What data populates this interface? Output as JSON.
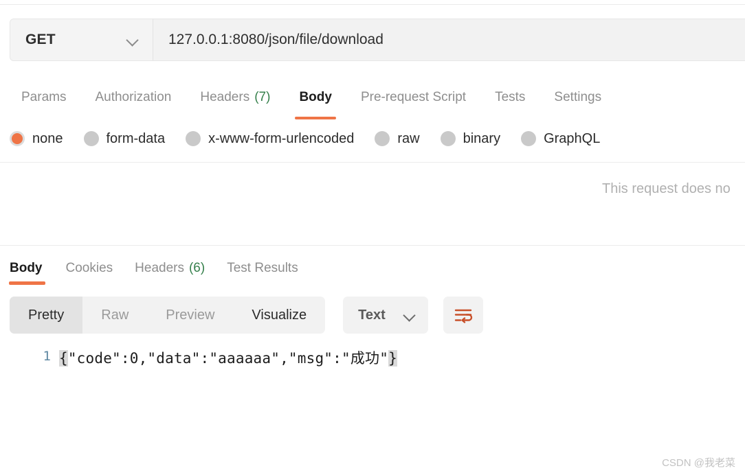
{
  "request_bar": {
    "method": "GET",
    "method_caret": "chevron-down-icon",
    "url": "127.0.0.1:8080/json/file/download"
  },
  "request_tabs": [
    {
      "label": "Params",
      "count": "",
      "active": false
    },
    {
      "label": "Authorization",
      "count": "",
      "active": false
    },
    {
      "label": "Headers",
      "count": "(7)",
      "active": false
    },
    {
      "label": "Body",
      "count": "",
      "active": true
    },
    {
      "label": "Pre-request Script",
      "count": "",
      "active": false
    },
    {
      "label": "Tests",
      "count": "",
      "active": false
    },
    {
      "label": "Settings",
      "count": "",
      "active": false
    }
  ],
  "body_types": [
    {
      "label": "none",
      "selected": true
    },
    {
      "label": "form-data",
      "selected": false
    },
    {
      "label": "x-www-form-urlencoded",
      "selected": false
    },
    {
      "label": "raw",
      "selected": false
    },
    {
      "label": "binary",
      "selected": false
    },
    {
      "label": "GraphQL",
      "selected": false
    }
  ],
  "empty_body_note": "This request does no",
  "response_tabs": [
    {
      "label": "Body",
      "count": "",
      "active": true
    },
    {
      "label": "Cookies",
      "count": "",
      "active": false
    },
    {
      "label": "Headers",
      "count": "(6)",
      "active": false
    },
    {
      "label": "Test Results",
      "count": "",
      "active": false
    }
  ],
  "viewer_toolbar": {
    "modes": [
      {
        "label": "Pretty",
        "active": true,
        "strong": false
      },
      {
        "label": "Raw",
        "active": false,
        "strong": false
      },
      {
        "label": "Preview",
        "active": false,
        "strong": false
      },
      {
        "label": "Visualize",
        "active": false,
        "strong": true
      }
    ],
    "format_select": {
      "value": "Text",
      "caret": "chevron-down-icon"
    },
    "wrap_button": {
      "icon": "word-wrap-icon",
      "color": "#c8502a"
    }
  },
  "response_body": {
    "line_number": "1",
    "open_brace": "{",
    "content": "\"code\":0,\"data\":\"aaaaaa\",\"msg\":\"成功\"",
    "close_brace": "}"
  },
  "watermark": "CSDN @我老菜",
  "colors": {
    "accent": "#ef7446",
    "count_green": "#36804c",
    "gutter_blue": "#5d87a1",
    "panel_gray": "#f2f2f2"
  }
}
